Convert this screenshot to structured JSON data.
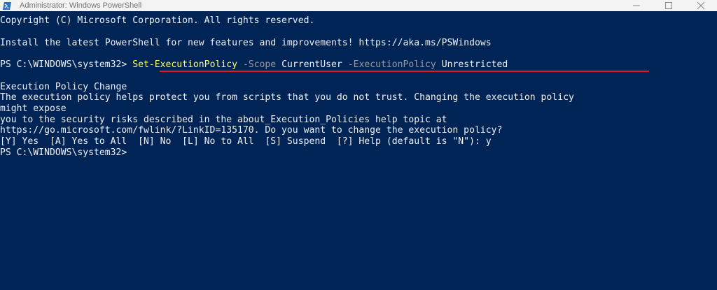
{
  "window": {
    "title": "Administrator: Windows PowerShell",
    "icon": "powershell-icon",
    "controls": [
      "minimize-icon",
      "maximize-icon",
      "close-icon"
    ]
  },
  "console": {
    "copyright": "Copyright (C) Microsoft Corporation. All rights reserved.",
    "install_notice": "Install the latest PowerShell for new features and improvements! https://aka.ms/PSWindows",
    "prompt1": "PS C:\\WINDOWS\\system32> ",
    "command": {
      "cmdlet": "Set-ExecutionPolicy",
      "param1": "-Scope",
      "arg1": "CurrentUser",
      "param2": "-ExecutionPolicy",
      "arg2": "Unrestricted"
    },
    "policy_heading": "Execution Policy Change",
    "policy_line1": "The execution policy helps protect you from scripts that you do not trust. Changing the execution policy",
    "policy_line2": "might expose",
    "policy_line3": "you to the security risks described in the about_Execution_Policies help topic at",
    "policy_line4": "https://go.microsoft.com/fwlink/?LinkID=135170. Do you want to change the execution policy?",
    "choices": "[Y] Yes  [A] Yes to All  [N] No  [L] No to All  [S] Suspend  [?] Help (default is \"N\"): y",
    "prompt2": "PS C:\\WINDOWS\\system32>"
  },
  "colors": {
    "background": "#012456",
    "text": "#f0f0f0",
    "command": "#ffff60",
    "parameter": "#9a9a9a",
    "annotation_underline": "#e6162d"
  }
}
